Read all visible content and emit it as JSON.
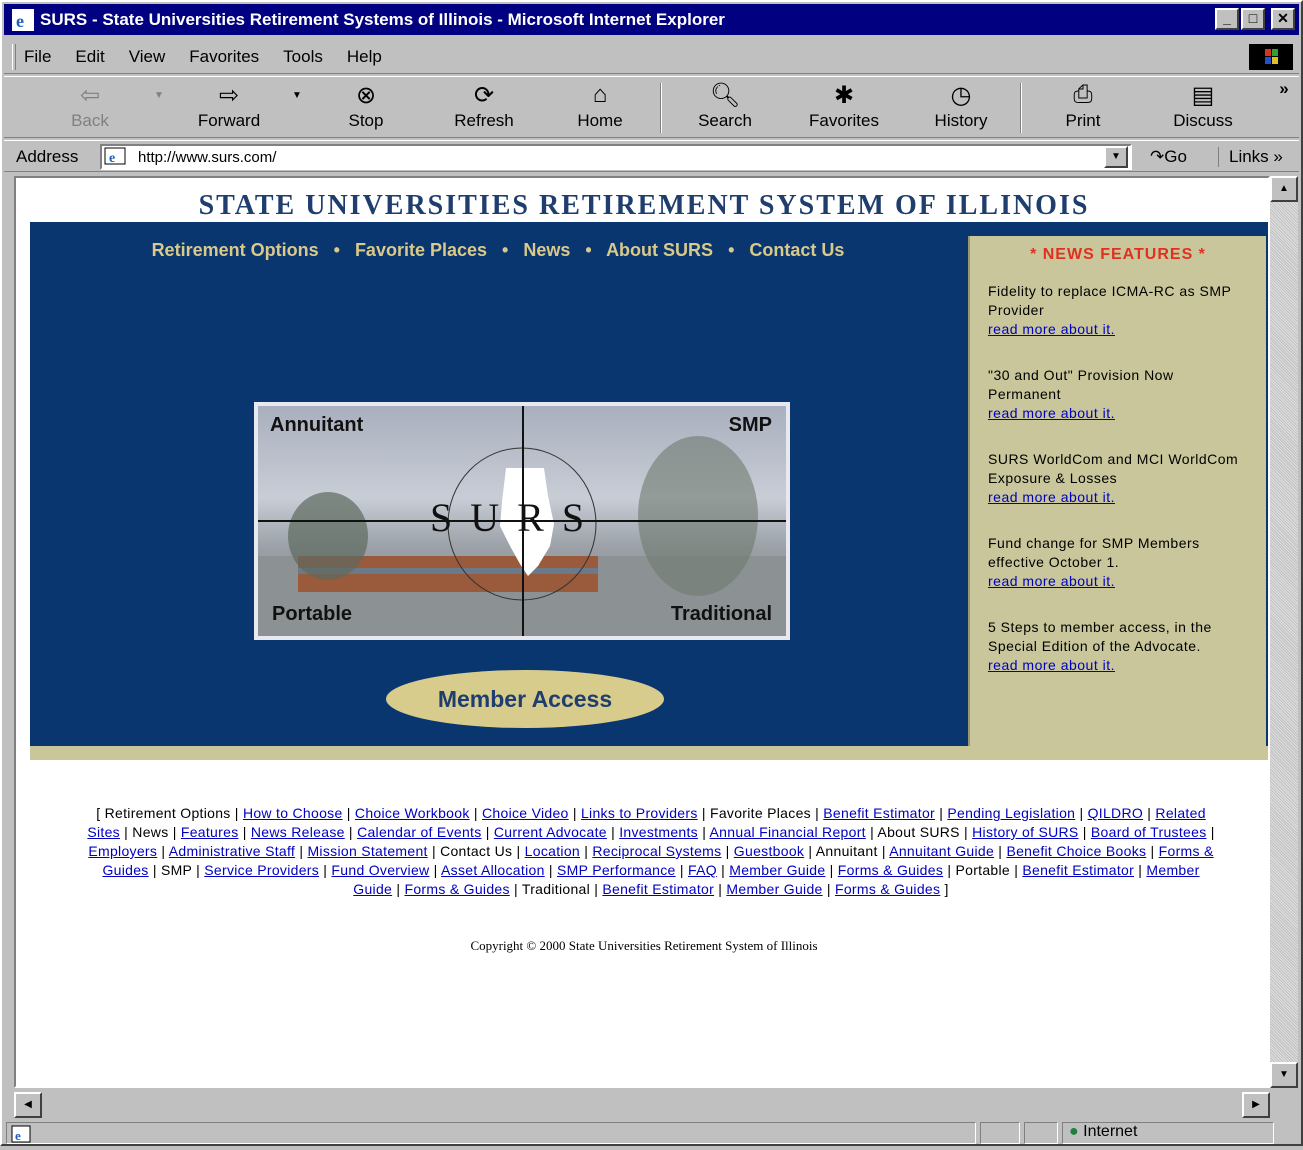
{
  "window": {
    "title": "SURS - State Universities Retirement Systems of Illinois - Microsoft Internet Explorer",
    "minimize": "_",
    "maximize": "□",
    "close": "✕"
  },
  "menu": {
    "items": [
      "File",
      "Edit",
      "View",
      "Favorites",
      "Tools",
      "Help"
    ]
  },
  "toolbar": {
    "back": "Back",
    "forward": "Forward",
    "stop": "Stop",
    "refresh": "Refresh",
    "home": "Home",
    "search": "Search",
    "favorites": "Favorites",
    "history": "History",
    "print": "Print",
    "discuss": "Discuss",
    "more": "»"
  },
  "address": {
    "label": "Address",
    "url": "http://www.surs.com/",
    "go": "Go",
    "links": "Links »"
  },
  "page": {
    "site_title": "STATE UNIVERSITIES RETIREMENT SYSTEM OF ILLINOIS",
    "nav": [
      "Retirement Options",
      "Favorite Places",
      "News",
      "About SURS",
      "Contact Us"
    ],
    "nav_separator": "•",
    "hero": {
      "top_left": "Annuitant",
      "top_right": "SMP",
      "bottom_left": "Portable",
      "bottom_right": "Traditional",
      "logo_text": "SURS"
    },
    "member_access": "Member Access",
    "news": {
      "header": "* NEWS FEATURES *",
      "items": [
        {
          "text": "Fidelity to replace ICMA-RC as SMP Provider",
          "link": "read more about it."
        },
        {
          "text": "\"30 and Out\" Provision Now Permanent",
          "link": "read more about it."
        },
        {
          "text": "SURS WorldCom and MCI WorldCom Exposure & Losses",
          "link": "read more about it."
        },
        {
          "text": "Fund change for SMP Members effective October 1.",
          "link": "read more about it."
        },
        {
          "text": "5 Steps to member access, in the Special Edition of the Advocate.",
          "link": "read more about it."
        }
      ]
    },
    "footer_links": {
      "how_to_choose": "How to Choose",
      "choice_workbook": "Choice Workbook",
      "choice_video": "Choice Video",
      "links_to_providers": "Links to Providers",
      "benefit_estimator": "Benefit Estimator",
      "pending_legislation": "Pending Legislation",
      "qildro": "QILDRO",
      "related_sites": "Related Sites",
      "features": "Features",
      "news_release": "News Release",
      "calendar_of_events": "Calendar of Events",
      "current_advocate": "Current Advocate",
      "investments": "Investments",
      "annual_financial_report": "Annual Financial Report",
      "history_of_surs": "History of SURS",
      "board_of_trustees": "Board of Trustees",
      "employers": "Employers",
      "administrative_staff": "Administrative Staff",
      "mission_statement": "Mission Statement",
      "location": "Location",
      "reciprocal_systems": "Reciprocal Systems",
      "guestbook": "Guestbook",
      "annuitant_guide": "Annuitant Guide",
      "benefit_choice_books": "Benefit Choice Books",
      "forms_guides": "Forms & Guides",
      "service_providers": "Service Providers",
      "fund_overview": "Fund Overview",
      "asset_allocation": "Asset Allocation",
      "smp_performance": "SMP Performance",
      "faq": "FAQ",
      "member_guide": "Member Guide"
    },
    "footer_labels": {
      "retirement_options": "[ Retirement Options |",
      "favorite_places": "| Favorite Places |",
      "news": "| News |",
      "about_surs": "| About SURS |",
      "contact_us": "| Contact Us |",
      "annuitant": "| Annuitant |",
      "smp": "| SMP |",
      "portable": "| Portable |",
      "traditional": "| Traditional |",
      "pipe": "|",
      "close": "]"
    },
    "copyright": "Copyright © 2000 State Universities Retirement System of Illinois"
  },
  "status": {
    "zone": "Internet"
  }
}
